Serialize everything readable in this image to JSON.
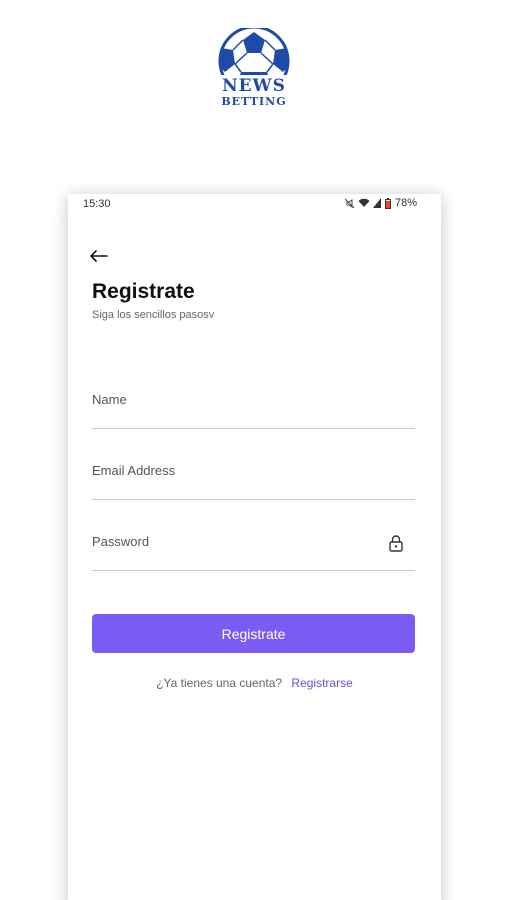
{
  "logo": {
    "line1": "NEWS",
    "line2": "BETTING",
    "color": "#1f4aa8"
  },
  "status_bar": {
    "time": "15:30",
    "battery": "78%",
    "icons": [
      "mute-icon",
      "wifi-icon",
      "signal-icon",
      "battery-icon"
    ]
  },
  "screen": {
    "back_icon": "arrow-left-icon",
    "title": "Registrate",
    "subtitle": "Siga los sencillos pasosv"
  },
  "form": {
    "name_label": "Name",
    "email_label": "Email Address",
    "password_label": "Password",
    "password_icon": "lock-icon",
    "submit_label": "Registrate"
  },
  "footer": {
    "question": "¿Ya tienes una cuenta?",
    "link": "Registrarse"
  },
  "colors": {
    "accent": "#7b5cf2",
    "link": "#6a4fe0",
    "logo_blue": "#1f4aa8"
  }
}
